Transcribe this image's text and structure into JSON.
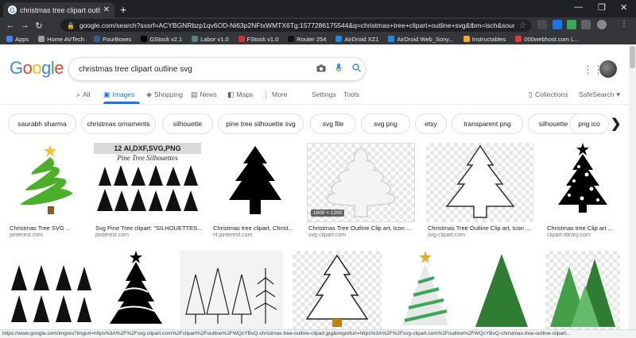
{
  "browser": {
    "tab_title": "christmas tree clipart outline svg",
    "tab_favicon": "G",
    "url": "google.com/search?sxsrf=ACYBGNRbzp1qv6OD-Ni63p2NFtxWMTX6Tg:1577286175544&q=christmas+tree+clipart+outline+svg&tbm=isch&source=univ...",
    "bookmarks": [
      {
        "label": "Apps",
        "color": "#4285f4"
      },
      {
        "label": "Home AVTech",
        "color": "#9e9e9e"
      },
      {
        "label": "FourBoxes",
        "color": "#3b5998"
      },
      {
        "label": "GStock v2.1",
        "color": "#000000"
      },
      {
        "label": "Labor v1.0",
        "color": "#607d8b"
      },
      {
        "label": "FStock v1.0",
        "color": "#d32f2f"
      },
      {
        "label": "Router 254",
        "color": "#111111"
      },
      {
        "label": "AirDroid XZ1",
        "color": "#1e88e5"
      },
      {
        "label": "AirDroid Web_Sony...",
        "color": "#1e88e5"
      },
      {
        "label": "Instructables",
        "color": "#f9a825"
      },
      {
        "label": "000webhost.com L...",
        "color": "#e53935"
      }
    ]
  },
  "google": {
    "logo": [
      "G",
      "o",
      "o",
      "g",
      "l",
      "e"
    ],
    "logo_colors": [
      "#4285f4",
      "#ea4335",
      "#fbbc05",
      "#4285f4",
      "#34a853",
      "#ea4335"
    ],
    "query": "christmas tree clipart outline svg",
    "tabs": [
      {
        "label": "All",
        "icon": "search-icon"
      },
      {
        "label": "Images",
        "icon": "image-icon"
      },
      {
        "label": "Shopping",
        "icon": "tag-icon"
      },
      {
        "label": "News",
        "icon": "news-icon"
      },
      {
        "label": "Maps",
        "icon": "map-icon"
      },
      {
        "label": "More",
        "icon": "more-icon"
      }
    ],
    "settings": "Settings",
    "tools": "Tools",
    "collections": "Collections",
    "safesearch": "SafeSearch",
    "accent": "#1a73e8"
  },
  "chips": [
    "saurabh sharma",
    "christmas ornaments",
    "silhouette",
    "pine tree silhouette svg",
    "svg file",
    "svg png",
    "etsy",
    "transparent png",
    "silhouette cameo",
    "png ico"
  ],
  "results": [
    {
      "caption": "Christmas Tree SVG ...",
      "source": "pinterest.com"
    },
    {
      "caption": "Svg Pine Tree clipart: \"SILHOUETTES...",
      "source": "pinterest.com",
      "overlay_title": "12 AI,DXF,SVG,PNG",
      "overlay_sub": "Pine Tree Silhouettes"
    },
    {
      "caption": "Christmas tree clipart, Christ...",
      "source": "nl.pinterest.com"
    },
    {
      "caption": "Christmas Tree Outline Clip art, Icon ...",
      "source": "svg-clipart.com",
      "dims": "1600 × 1200"
    },
    {
      "caption": "Christmas Tree Outline Clip art, Icon ...",
      "source": "svg-clipart.com"
    },
    {
      "caption": "Christmas tree Clip art ...",
      "source": "clipart-library.com"
    }
  ],
  "status_url": "https://www.google.com/imgres?imgurl=https%3A%2F%2Fsvg-clipart.com%2Fclipart%2Foutline%2FWQcYBvQ-christmas-tree-outline-clipart.jpg&imgrefurl=https%3A%2F%2Fsvg-clipart.com%2Foutline%2FWQcYBvQ-christmas-tree-outline-clipart..."
}
